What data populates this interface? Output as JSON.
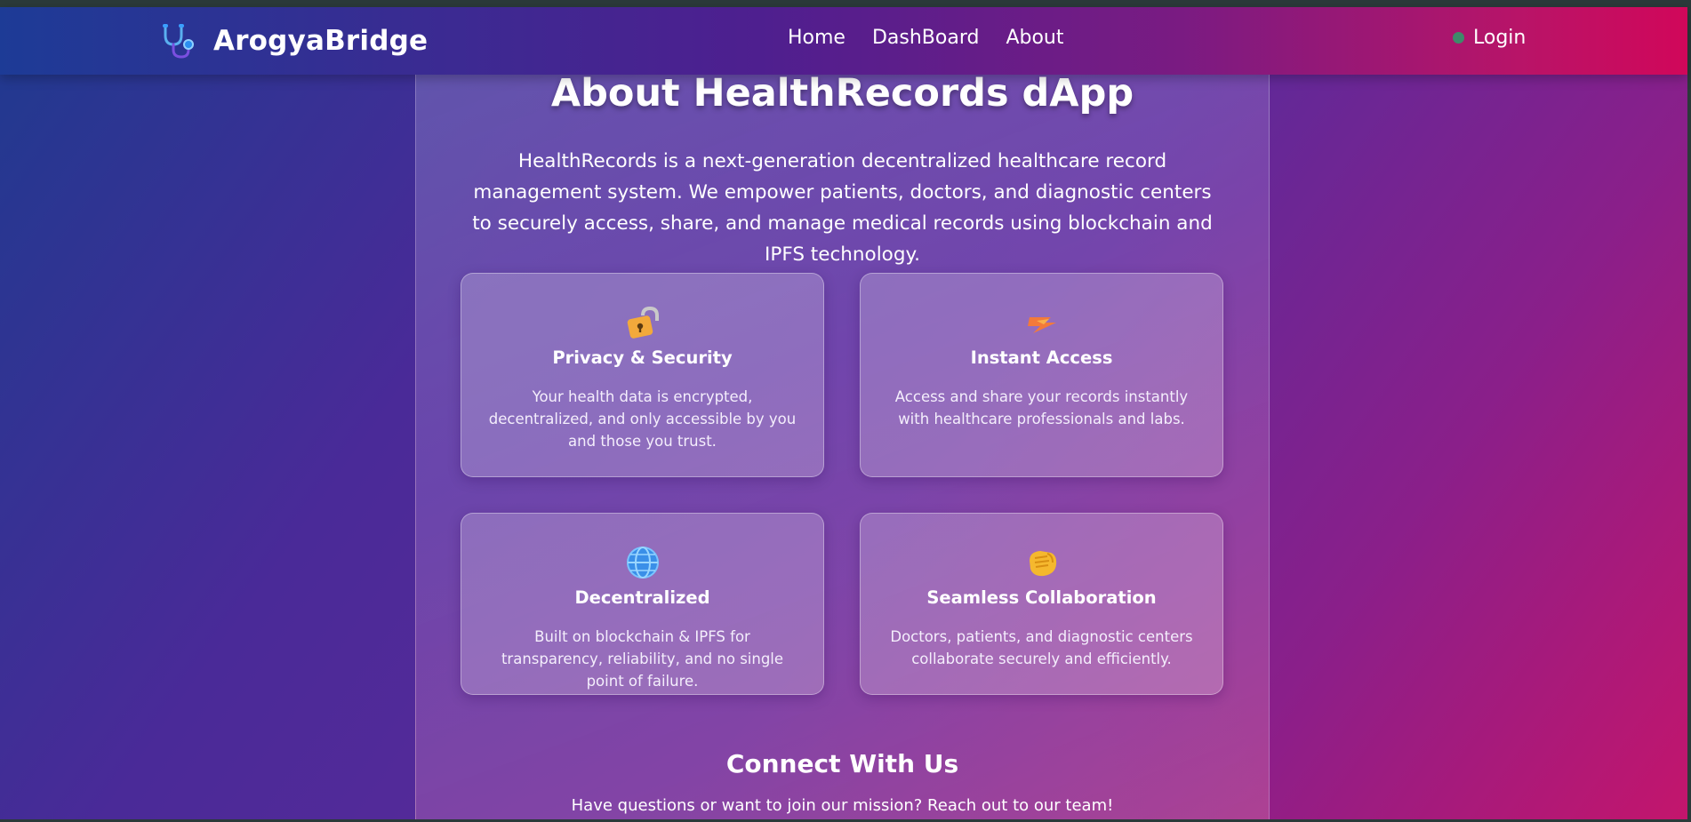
{
  "navbar": {
    "brand_name": "ArogyaBridge",
    "brand_icon": "stethoscope-icon",
    "links": [
      "Home",
      "DashBoard",
      "About"
    ],
    "login_label": "Login",
    "status_color": "#3e8a6a"
  },
  "about": {
    "title": "About HealthRecords dApp",
    "description": "HealthRecords is a next-generation decentralized healthcare record management system. We empower patients, doctors, and diagnostic centers to securely access, share, and manage medical records using blockchain and IPFS technology."
  },
  "features": [
    {
      "icon": "lock-icon",
      "title": "Privacy & Security",
      "text": "Your health data is encrypted, decentralized, and only accessible by you and those you trust."
    },
    {
      "icon": "lightning-icon",
      "title": "Instant Access",
      "text": "Access and share your records instantly with healthcare professionals and labs."
    },
    {
      "icon": "globe-icon",
      "title": "Decentralized",
      "text": "Built on blockchain & IPFS for transparency, reliability, and no single point of failure."
    },
    {
      "icon": "handshake-icon",
      "title": "Seamless Collaboration",
      "text": "Doctors, patients, and diagnostic centers collaborate securely and efficiently."
    }
  ],
  "connect": {
    "title": "Connect With Us",
    "text": "Have questions or want to join our mission? Reach out to our team!"
  }
}
